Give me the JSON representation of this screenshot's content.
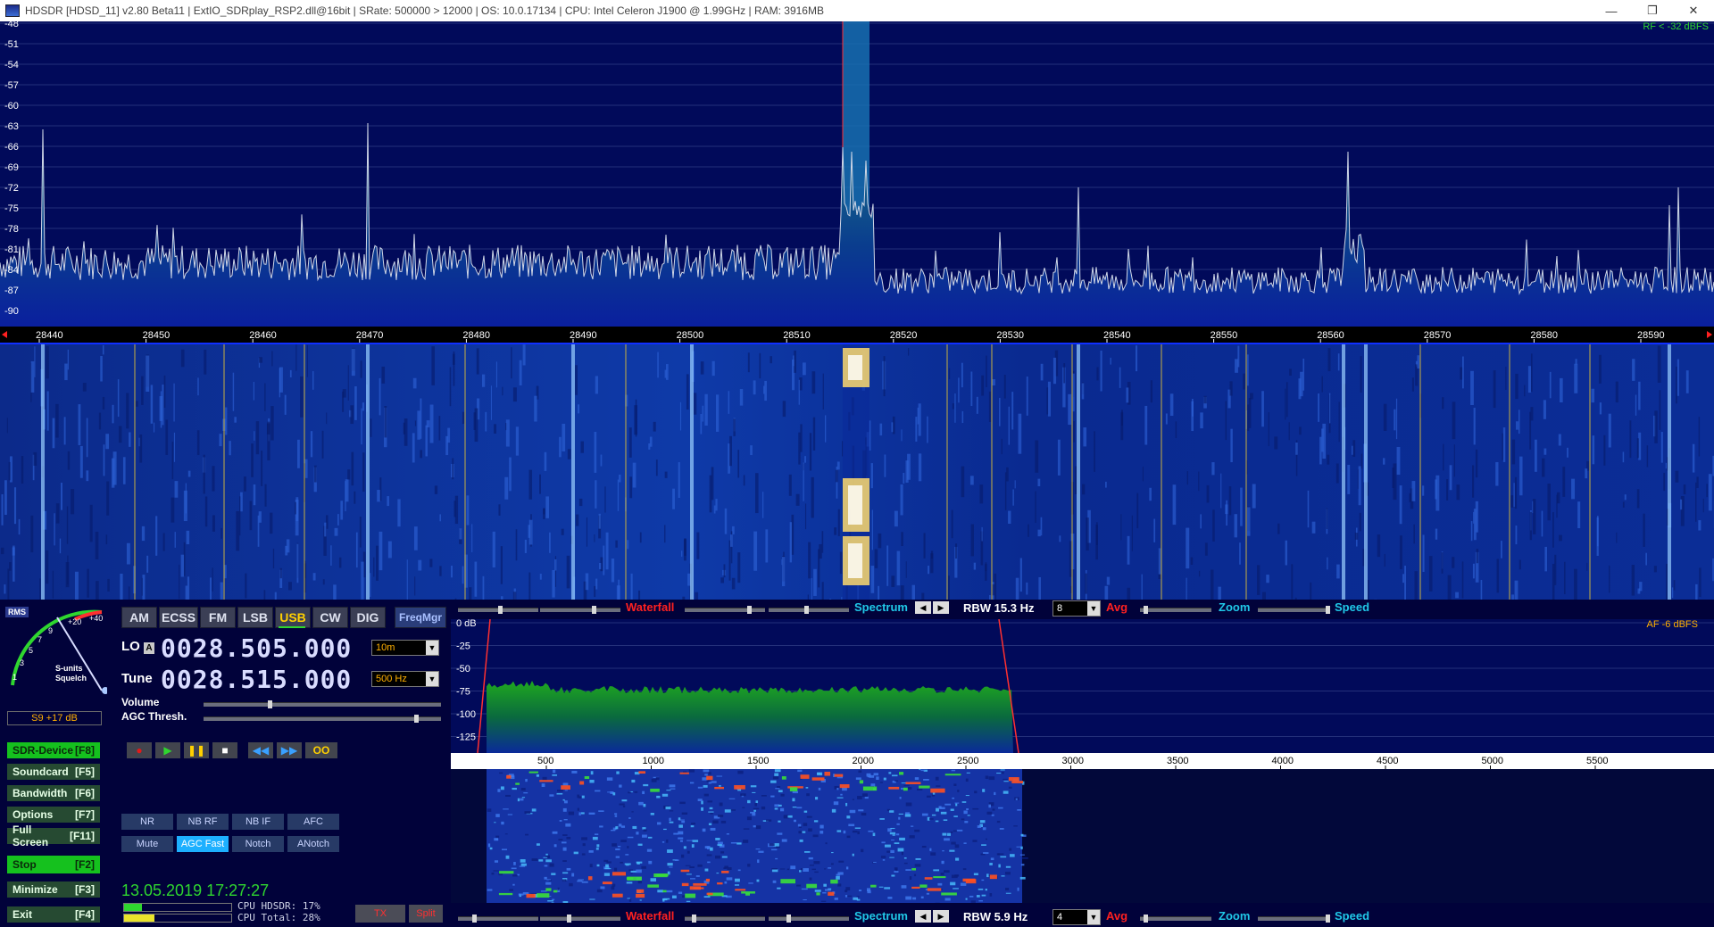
{
  "titlebar": {
    "text": "HDSDR  [HDSD_11]  v2.80 Beta11  |  ExtIO_SDRplay_RSP2.dll@16bit  |  SRate: 500000 > 12000  |  OS: 10.0.17134   |  CPU: Intel Celeron  J1900  @ 1.99GHz  |  RAM: 3916MB",
    "minimize": "—",
    "restore": "❐",
    "close": "✕"
  },
  "rf_spectrum": {
    "db_labels": [
      "-48",
      "-51",
      "-54",
      "-57",
      "-60",
      "-63",
      "-66",
      "-69",
      "-72",
      "-75",
      "-78",
      "-81",
      "-84",
      "-87",
      "-90"
    ],
    "level": "RF < -32 dBFS",
    "freq_labels": [
      "28440",
      "28450",
      "28460",
      "28470",
      "28480",
      "28490",
      "28500",
      "28510",
      "28520",
      "28530",
      "28540",
      "28550",
      "28560",
      "28570",
      "28580",
      "28590"
    ]
  },
  "smeter": {
    "rms": "RMS",
    "scale": [
      "1",
      "3",
      "5",
      "7",
      "9",
      "+20",
      "+40"
    ],
    "label1": "S-units",
    "label2": "Squelch",
    "reading": "S9 +17 dB"
  },
  "modes": [
    "AM",
    "ECSS",
    "FM",
    "LSB",
    "USB",
    "CW",
    "DIG"
  ],
  "active_mode": "USB",
  "freqmgr": "FreqMgr",
  "lo": {
    "label": "LO",
    "a": "A",
    "value": "0028.505.000",
    "band": "10m"
  },
  "tune": {
    "label": "Tune",
    "value": "0028.515.000",
    "step": "500 Hz"
  },
  "volume_label": "Volume",
  "agc_label": "AGC Thresh.",
  "transport": {
    "rec": "●",
    "play": "▶",
    "pause": "❚❚",
    "stop": "■",
    "rew": "◀◀",
    "ffw": "▶▶",
    "loop": "OO"
  },
  "function_buttons": [
    {
      "label": "SDR-Device",
      "key": "[F8]"
    },
    {
      "label": "Soundcard",
      "key": "[F5]"
    },
    {
      "label": "Bandwidth",
      "key": "[F6]"
    },
    {
      "label": "Options",
      "key": "[F7]"
    },
    {
      "label": "Full Screen",
      "key": "[F11]"
    },
    {
      "label": "Stop",
      "key": "[F2]"
    },
    {
      "label": "Minimize",
      "key": "[F3]"
    },
    {
      "label": "Exit",
      "key": "[F4]"
    }
  ],
  "dsp_row1": [
    "NR",
    "NB RF",
    "NB IF",
    "AFC"
  ],
  "dsp_row2": [
    "Mute",
    "AGC Fast",
    "Notch",
    "ANotch"
  ],
  "datetime": "13.05.2019 17:27:27",
  "cpu": {
    "hdsdr": "CPU HDSDR: 17%",
    "total": "CPU Total: 28%"
  },
  "tx": "TX",
  "split": "Split",
  "rf_toolbar": {
    "waterfall": "Waterfall",
    "spectrum": "Spectrum",
    "rbw": "RBW 15.3 Hz",
    "avg_value": "8",
    "avg": "Avg",
    "zoom": "Zoom",
    "speed": "Speed"
  },
  "af_toolbar": {
    "waterfall": "Waterfall",
    "spectrum": "Spectrum",
    "rbw": "RBW  5.9 Hz",
    "avg_value": "4",
    "avg": "Avg",
    "zoom": "Zoom",
    "speed": "Speed"
  },
  "af_spectrum": {
    "level": "AF  -6 dBFS",
    "db_labels": [
      "0 dB",
      "-25",
      "-50",
      "-75",
      "-100",
      "-125"
    ],
    "freq_labels": [
      "500",
      "1000",
      "1500",
      "2000",
      "2500",
      "3000",
      "3500",
      "4000",
      "4500",
      "5000",
      "5500"
    ]
  },
  "colors": {
    "bg": "#02053a",
    "spectrum": "#010a5a",
    "accent_green": "#15c11e",
    "active_mode": "#ffd000"
  }
}
